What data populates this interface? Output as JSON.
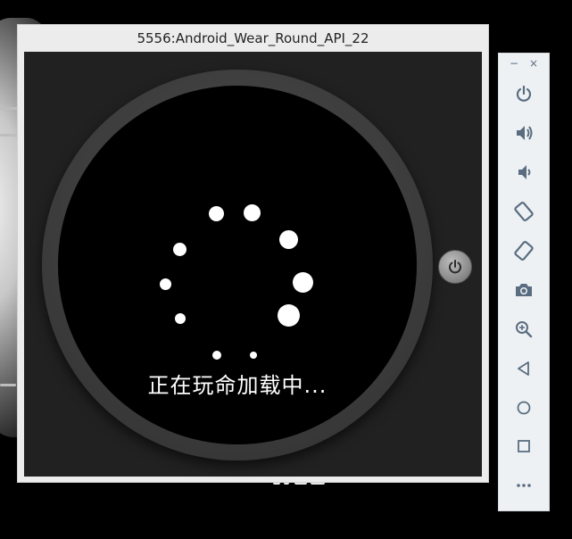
{
  "window": {
    "title": "5556:Android_Wear_Round_API_22"
  },
  "watch": {
    "loading_text": "正在玩命加载中...",
    "hardware_button_icon": "power-icon"
  },
  "toolbar": {
    "minimize_label": "−",
    "close_label": "×",
    "buttons": [
      {
        "name": "power-button",
        "icon": "power-icon"
      },
      {
        "name": "volume-up-button",
        "icon": "volume-up-icon"
      },
      {
        "name": "volume-down-button",
        "icon": "volume-down-icon"
      },
      {
        "name": "rotate-left-button",
        "icon": "rotate-left-icon"
      },
      {
        "name": "rotate-right-button",
        "icon": "rotate-right-icon"
      },
      {
        "name": "screenshot-button",
        "icon": "camera-icon"
      },
      {
        "name": "zoom-button",
        "icon": "zoom-icon"
      },
      {
        "name": "back-button",
        "icon": "back-triangle-icon"
      },
      {
        "name": "home-button",
        "icon": "home-circle-icon"
      },
      {
        "name": "overview-button",
        "icon": "overview-square-icon"
      },
      {
        "name": "more-button",
        "icon": "more-dots-icon"
      }
    ],
    "icon_color": "#5a6d80"
  },
  "colors": {
    "screen": "#212121",
    "bezel": "#3c3c3c",
    "face": "#000000",
    "window": "#ececec"
  }
}
